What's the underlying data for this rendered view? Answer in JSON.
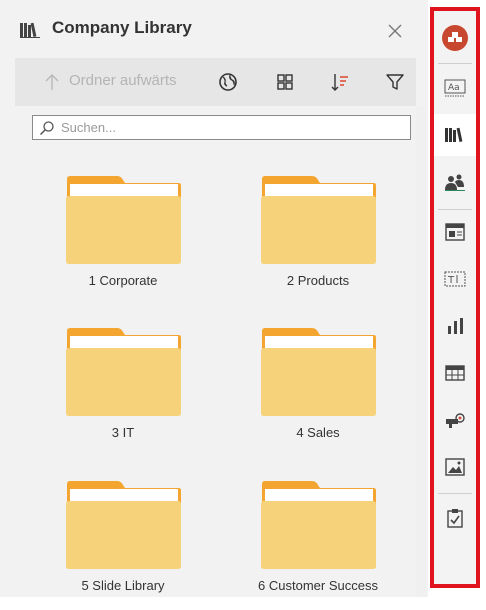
{
  "panel": {
    "title": "Company Library",
    "toolbar": {
      "up_label": "Ordner aufwärts",
      "icons": [
        "arrow-up-icon",
        "globe-icon",
        "grid-view-icon",
        "sort-icon",
        "filter-icon"
      ]
    },
    "search": {
      "placeholder": "Suchen...",
      "value": ""
    },
    "folders": [
      {
        "label": "1 Corporate"
      },
      {
        "label": "2 Products"
      },
      {
        "label": "3 IT"
      },
      {
        "label": "4 Sales"
      },
      {
        "label": "5 Slide Library"
      },
      {
        "label": "6 Customer Success"
      }
    ]
  },
  "ribbon": {
    "items": [
      "app-logo-icon",
      "text-styles-icon",
      "library-icon",
      "people-icon",
      "layout-icon",
      "textbox-icon",
      "bar-chart-icon",
      "table-icon",
      "shapes-icon",
      "image-icon",
      "clipboard-check-icon"
    ],
    "active_item": "library-icon",
    "accent_color": "#c8472f",
    "highlight_border_color": "#e0141e"
  },
  "colors": {
    "folder_back": "#f3a52f",
    "folder_front": "#f6d27a",
    "panel_bg": "#f2f2f2",
    "toolbar_bg": "#e6e6e6"
  }
}
